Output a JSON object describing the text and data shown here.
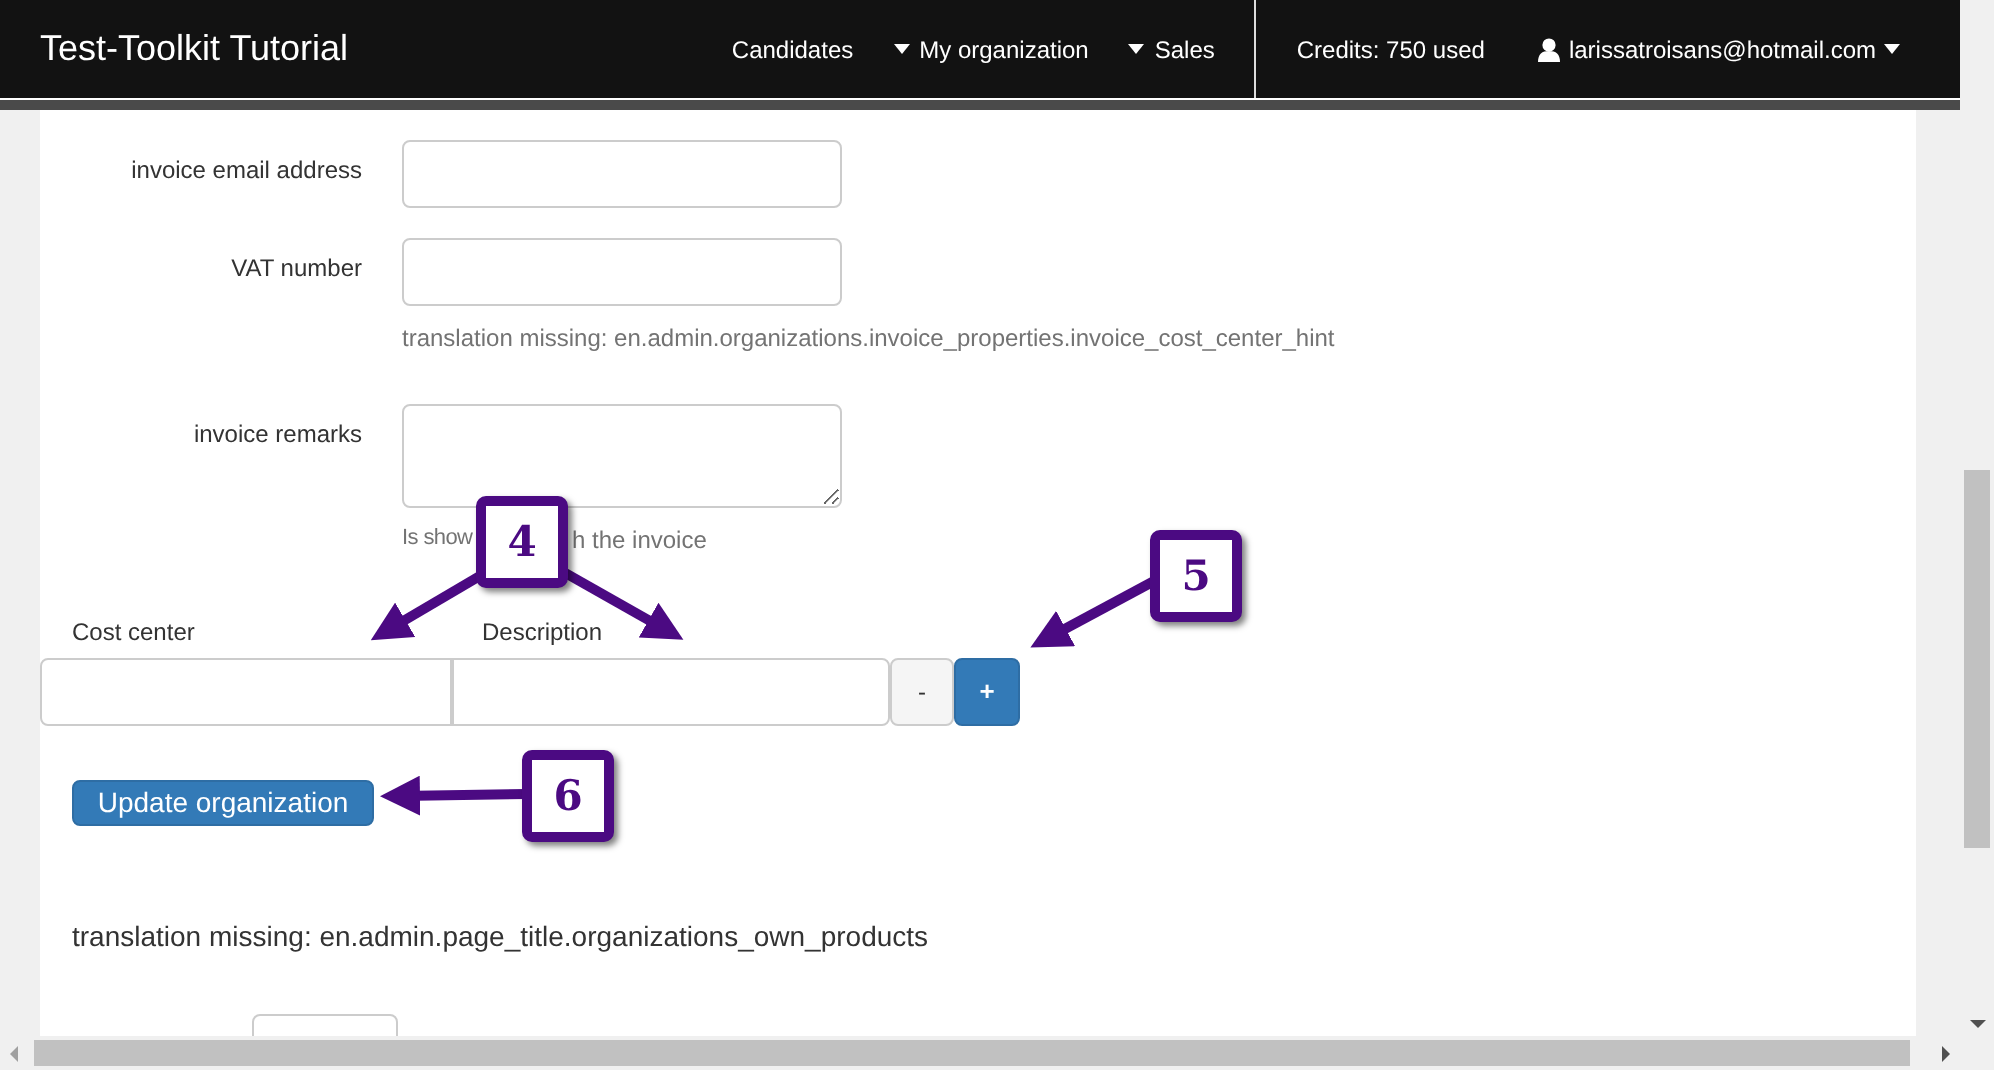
{
  "navbar": {
    "brand": "Test-Toolkit Tutorial",
    "links": [
      {
        "label": "Candidates",
        "dropdown": false
      },
      {
        "label": "My organization",
        "dropdown": true
      },
      {
        "label": "Sales",
        "dropdown": true
      }
    ],
    "credits": "Credits: 750 used",
    "user": "larissatroisans@hotmail.com"
  },
  "form": {
    "fields": [
      {
        "label": "invoice email address",
        "kind": "input"
      },
      {
        "label": "VAT number",
        "kind": "input",
        "hint": "translation missing: en.admin.organizations.invoice_properties.invoice_cost_center_hint"
      },
      {
        "label": "invoice remarks",
        "kind": "textarea",
        "hint_parts": [
          "Is show",
          "h the invoice"
        ]
      }
    ],
    "cost_center": {
      "label": "Cost center"
    },
    "description": {
      "label": "Description"
    },
    "remove_button": "-",
    "add_button": "+",
    "submit_button": "Update organization"
  },
  "section_title": "translation missing: en.admin.page_title.organizations_own_products",
  "callouts": [
    {
      "number": "4"
    },
    {
      "number": "5"
    },
    {
      "number": "6"
    }
  ]
}
